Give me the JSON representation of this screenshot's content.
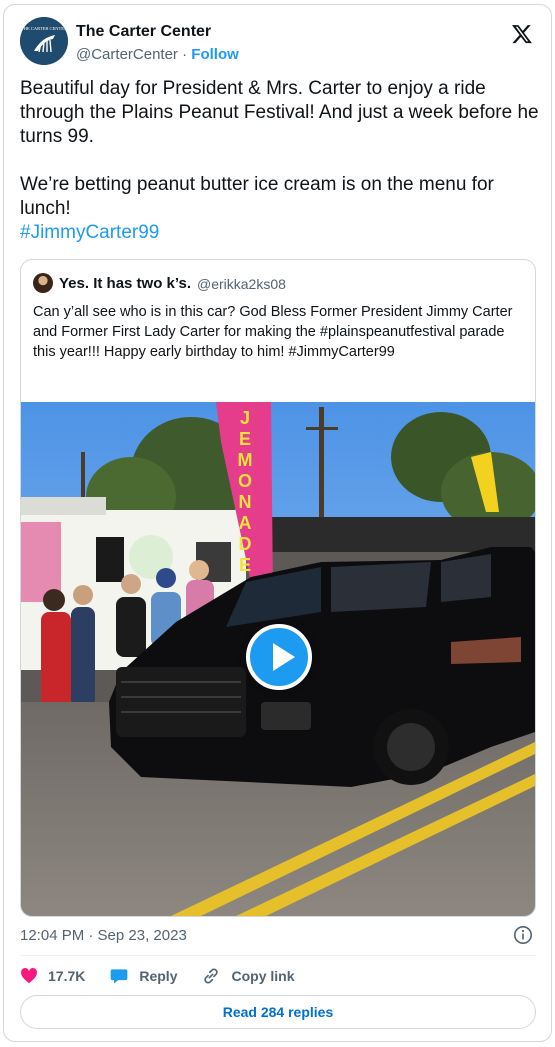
{
  "author": {
    "name": "The Carter Center",
    "handle": "@CarterCenter",
    "separator": "·",
    "follow_label": "Follow",
    "avatar_text": "THE CARTER CENTER"
  },
  "tweet": {
    "lines": [
      "Beautiful day for President & Mrs. Carter to enjoy a ride through the Plains Peanut Festival! And just a week before he turns 99.",
      "We’re betting peanut butter ice cream is on the menu for lunch!"
    ],
    "hashtag": "#JimmyCarter99"
  },
  "quoted": {
    "name": "Yes. It has two k’s.",
    "handle": "@erikka2ks08",
    "text": "Can y’all see who is in this car?  God Bless Former President Jimmy Carter and Former First Lady Carter for making the #plainspeanutfestival parade this year!!! Happy early birthday to him! #JimmyCarter99",
    "media_icon": "play-icon",
    "truck_sign_letters": [
      "J",
      "E",
      "M",
      "O",
      "N",
      "A",
      "D",
      "E"
    ]
  },
  "meta": {
    "timestamp": "12:04 PM · Sep 23, 2023"
  },
  "actions": {
    "like_count": "17.7K",
    "reply_label": "Reply",
    "copy_label": "Copy link",
    "read_replies_label": "Read 284 replies"
  },
  "colors": {
    "accent": "#1d9bf0",
    "text": "#0f1419",
    "muted": "#536471",
    "like": "#f91880",
    "border": "#cfd9de"
  }
}
